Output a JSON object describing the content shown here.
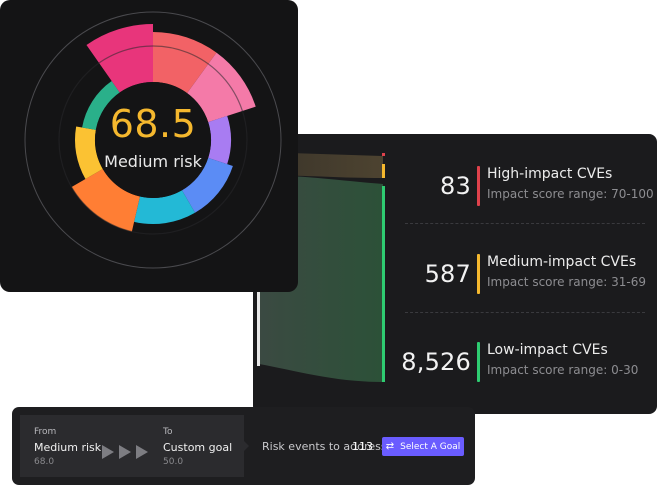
{
  "risk": {
    "score": "68.5",
    "label": "Medium risk",
    "colors": {
      "score": "#f5b82e",
      "segments": [
        "#e8357b",
        "#f26266",
        "#f47aa8",
        "#a87cf2",
        "#5b8cf5",
        "#23b9d6",
        "#ff7e34",
        "#fbc233",
        "#2ab08a"
      ]
    }
  },
  "cves": [
    {
      "count": "83",
      "title": "High-impact CVEs",
      "range": "Impact score range: 70-100",
      "color": "#e0424c"
    },
    {
      "count": "587",
      "title": "Medium-impact CVEs",
      "range": "Impact score range: 31-69",
      "color": "#f5b82e"
    },
    {
      "count": "8,526",
      "title": "Low-impact CVEs",
      "range": "Impact score range: 0-30",
      "color": "#2ecc71"
    }
  ],
  "goal": {
    "from_label": "From",
    "from_value": "Medium risk",
    "from_score": "68.0",
    "to_label": "To",
    "to_value": "Custom goal",
    "to_score": "50.0",
    "events_label": "Risk events to address",
    "events_count": "113",
    "button_label": "Select A Goal",
    "button_color": "#6a5cff"
  }
}
